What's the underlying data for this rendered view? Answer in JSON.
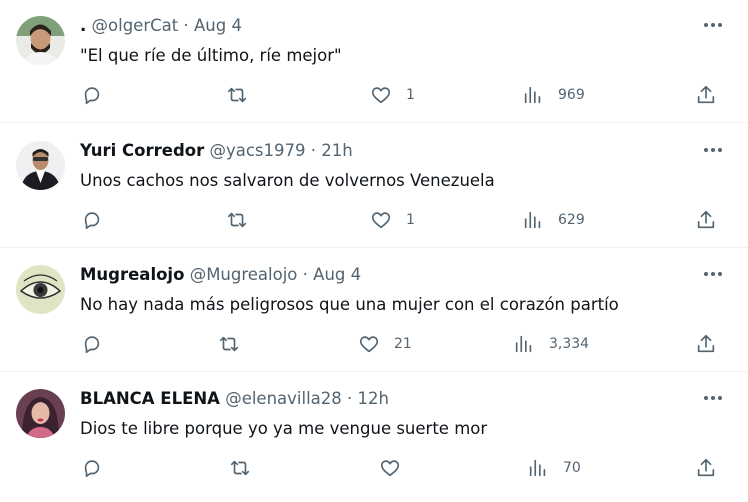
{
  "tweets": [
    {
      "name": ".",
      "handle": "@olgerCat",
      "sep": "·",
      "time": "Aug 4",
      "text": "\"El que ríe de último, ríe mejor\"",
      "likes": "1",
      "views": "969"
    },
    {
      "name": "Yuri Corredor",
      "handle": "@yacs1979",
      "sep": "·",
      "time": "21h",
      "text": "Unos cachos nos salvaron de volvernos Venezuela",
      "likes": "1",
      "views": "629"
    },
    {
      "name": "Mugrealojo",
      "handle": "@Mugrealojo",
      "sep": "·",
      "time": "Aug 4",
      "text": "No hay nada más peligrosos que una mujer con el corazón partío",
      "likes": "21",
      "views": "3,334"
    },
    {
      "name": "BLANCA ELENA",
      "handle": "@elenavilla28",
      "sep": "·",
      "time": "12h",
      "text": "Dios te libre porque yo ya me vengue suerte mor",
      "likes": "",
      "views": "70"
    }
  ],
  "icons": {
    "reply": "reply-icon",
    "retweet": "retweet-icon",
    "like": "heart-icon",
    "views": "views-icon",
    "share": "share-icon",
    "more": "more-icon"
  },
  "colors": {
    "text": "#0f1419",
    "secondary": "#536471",
    "divider": "#eff3f4"
  }
}
